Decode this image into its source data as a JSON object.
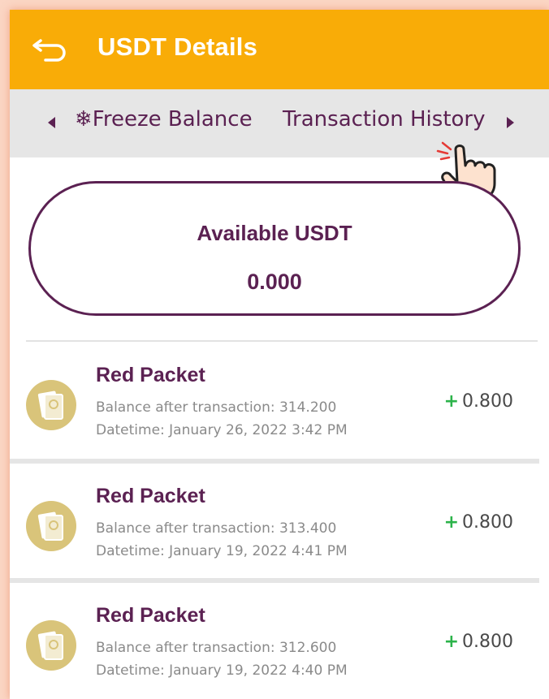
{
  "header": {
    "title": "USDT Details",
    "back_icon": "back-arrow-icon",
    "background_color": "#f9ac07"
  },
  "tabs": {
    "left_arrow_icon": "caret-left-icon",
    "right_arrow_icon": "caret-right-icon",
    "freeze_icon": "snowflake-icon",
    "items": [
      {
        "label": "Freeze Balance"
      },
      {
        "label": "Transaction History"
      }
    ]
  },
  "balance": {
    "label": "Available USDT",
    "value": "0.000"
  },
  "transactions": [
    {
      "title": "Red Packet",
      "balance_text": "Balance after transaction: 314.200",
      "datetime_text": "Datetime: January 26, 2022 3:42 PM",
      "sign": "+",
      "amount": "0.800",
      "icon": "red-packet-icon"
    },
    {
      "title": "Red Packet",
      "balance_text": "Balance after transaction: 313.400",
      "datetime_text": "Datetime: January 19, 2022 4:41 PM",
      "sign": "+",
      "amount": "0.800",
      "icon": "red-packet-icon"
    },
    {
      "title": "Red Packet",
      "balance_text": "Balance after transaction: 312.600",
      "datetime_text": "Datetime: January 19, 2022 4:40 PM",
      "sign": "+",
      "amount": "0.800",
      "icon": "red-packet-icon"
    }
  ],
  "colors": {
    "accent": "#f9ac07",
    "brand_purple": "#5b2152",
    "positive": "#2cb34a"
  }
}
